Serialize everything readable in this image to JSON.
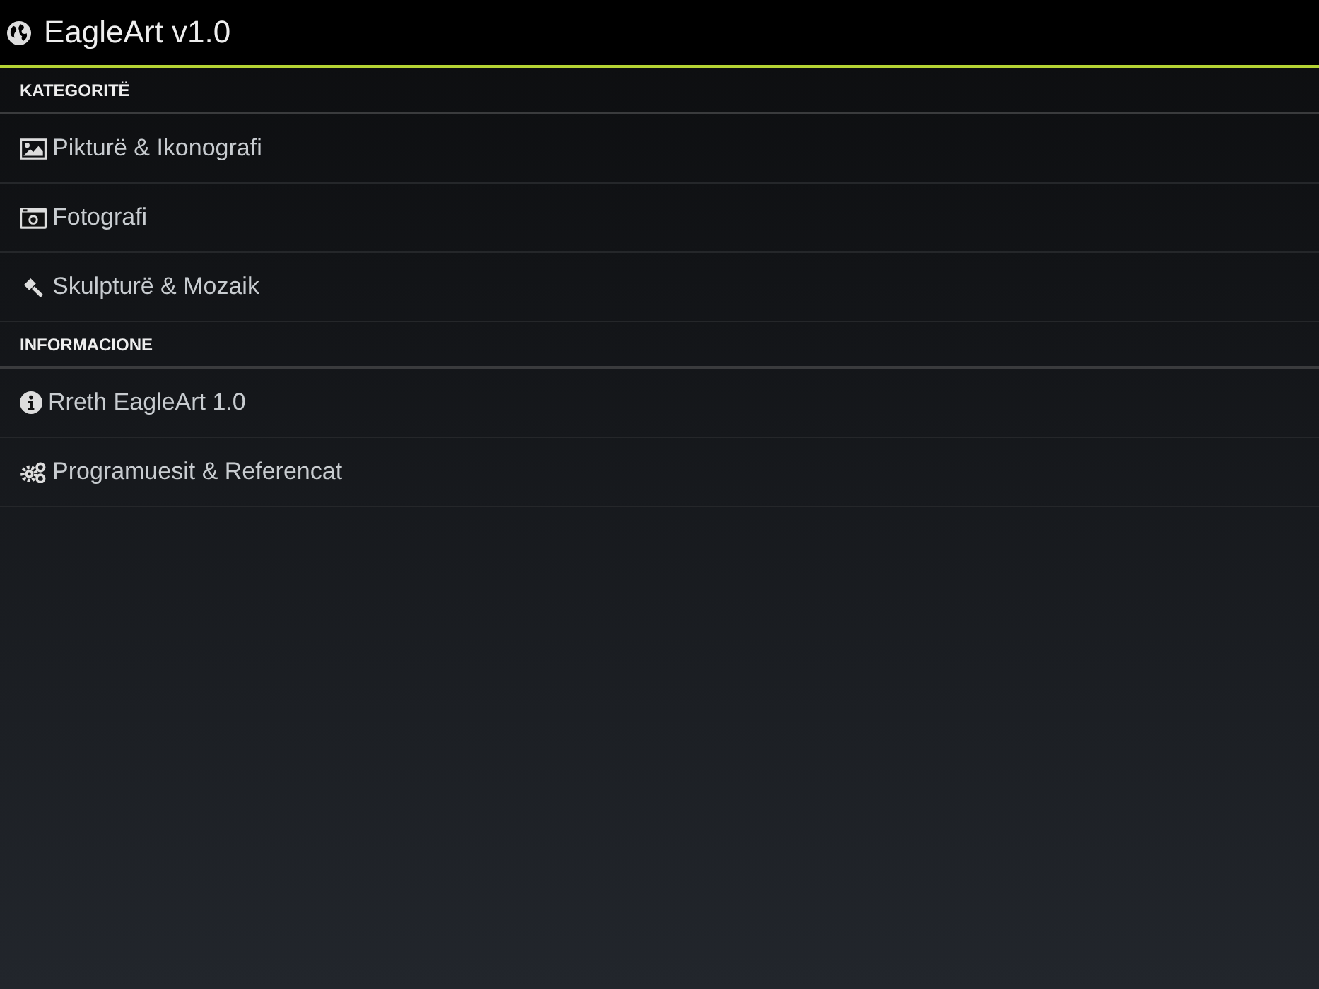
{
  "header": {
    "title": "EagleArt v1.0"
  },
  "sections": [
    {
      "title": "KATEGORITË",
      "items": [
        {
          "kind": "image",
          "label": "Pikturë & Ikonografi"
        },
        {
          "kind": "camera",
          "label": "Fotografi"
        },
        {
          "kind": "gavel",
          "label": "Skulpturë & Mozaik"
        }
      ]
    },
    {
      "title": "INFORMACIONE",
      "items": [
        {
          "kind": "info",
          "label": "Rreth EagleArt 1.0"
        },
        {
          "kind": "gears",
          "label": "Programuesit & Referencat"
        }
      ]
    }
  ]
}
